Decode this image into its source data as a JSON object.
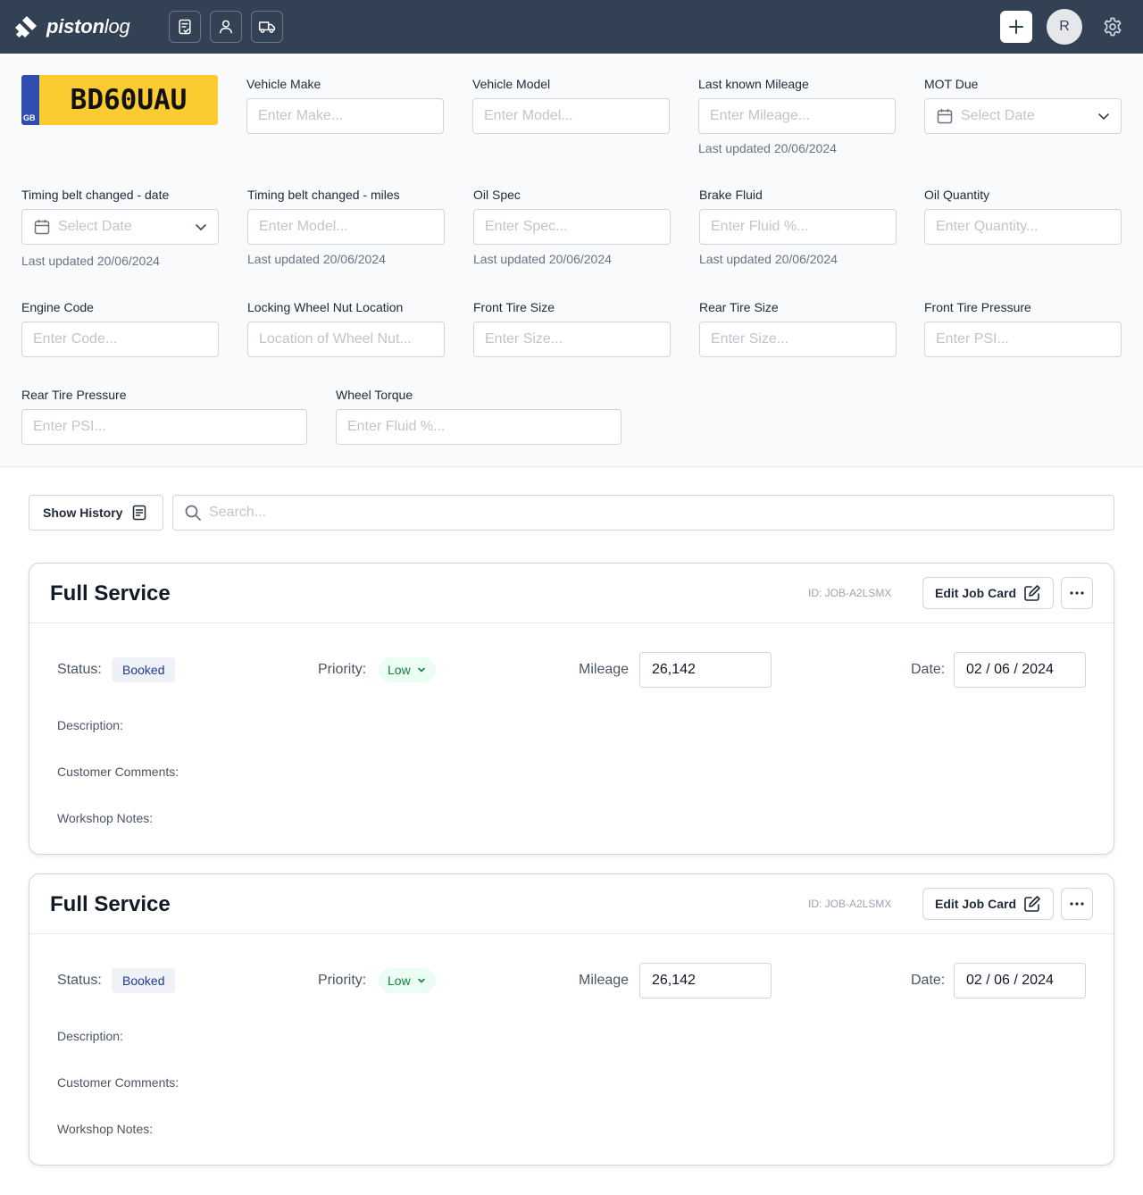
{
  "header": {
    "logo_bold": "piston",
    "logo_regular": "log",
    "avatar_initial": "R"
  },
  "vehicle": {
    "plate": {
      "country": "GB",
      "registration": "BD60UAU"
    },
    "make": {
      "label": "Vehicle Make",
      "placeholder": "Enter Make..."
    },
    "model": {
      "label": "Vehicle Model",
      "placeholder": "Enter Model..."
    },
    "mileage": {
      "label": "Last known Mileage",
      "placeholder": "Enter Mileage...",
      "hint": "Last updated 20/06/2024"
    },
    "mot_due": {
      "label": "MOT Due",
      "placeholder": "Select Date"
    },
    "timing_belt_date": {
      "label": "Timing belt changed - date",
      "placeholder": "Select Date",
      "hint": "Last updated 20/06/2024"
    },
    "timing_belt_miles": {
      "label": "Timing belt changed - miles",
      "placeholder": "Enter Model...",
      "hint": "Last updated 20/06/2024"
    },
    "oil_spec": {
      "label": "Oil Spec",
      "placeholder": "Enter Spec...",
      "hint": "Last updated 20/06/2024"
    },
    "brake_fluid": {
      "label": "Brake Fluid",
      "placeholder": "Enter Fluid %...",
      "hint": "Last updated 20/06/2024"
    },
    "oil_quantity": {
      "label": "Oil Quantity",
      "placeholder": "Enter Quantity..."
    },
    "engine_code": {
      "label": "Engine Code",
      "placeholder": "Enter Code..."
    },
    "wheel_nut": {
      "label": "Locking Wheel Nut Location",
      "placeholder": "Location of Wheel Nut..."
    },
    "front_tire_size": {
      "label": "Front Tire Size",
      "placeholder": "Enter Size..."
    },
    "rear_tire_size": {
      "label": "Rear Tire Size",
      "placeholder": "Enter Size..."
    },
    "front_tire_pressure": {
      "label": "Front Tire Pressure",
      "placeholder": "Enter PSI..."
    },
    "rear_tire_pressure": {
      "label": "Rear Tire Pressure",
      "placeholder": "Enter PSI..."
    },
    "wheel_torque": {
      "label": "Wheel Torque",
      "placeholder": "Enter Fluid %..."
    }
  },
  "toolbar": {
    "history_label": "Show History",
    "search_placeholder": "Search..."
  },
  "jobs": [
    {
      "title": "Full Service",
      "id": "ID: JOB-A2LSMX",
      "edit_label": "Edit Job Card",
      "status_label": "Status:",
      "status": "Booked",
      "priority_label": "Priority:",
      "priority": "Low",
      "mileage_label": "Mileage",
      "mileage": "26,142",
      "date_label": "Date:",
      "date": "02 / 06 / 2024",
      "description_label": "Description:",
      "customer_comments_label": "Customer Comments:",
      "workshop_notes_label": "Workshop Notes:"
    },
    {
      "title": "Full Service",
      "id": "ID: JOB-A2LSMX",
      "edit_label": "Edit Job Card",
      "status_label": "Status:",
      "status": "Booked",
      "priority_label": "Priority:",
      "priority": "Low",
      "mileage_label": "Mileage",
      "mileage": "26,142",
      "date_label": "Date:",
      "date": "02 / 06 / 2024",
      "description_label": "Description:",
      "customer_comments_label": "Customer Comments:",
      "workshop_notes_label": "Workshop Notes:"
    }
  ],
  "colors": {
    "topbar": "#334155",
    "plate_yellow": "#fbcb32",
    "plate_blue": "#2f4fb0",
    "status_text": "#1e3a8a",
    "priority_text": "#15803d"
  }
}
